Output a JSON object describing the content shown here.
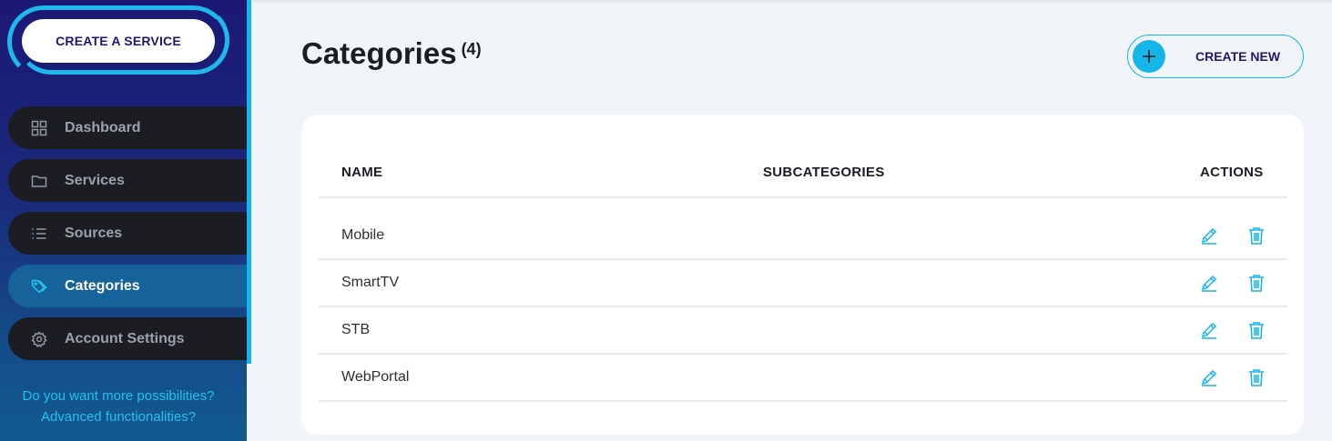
{
  "sidebar": {
    "create_service_label": "CREATE A SERVICE",
    "items": [
      {
        "label": "Dashboard",
        "icon": "grid-icon",
        "active": false
      },
      {
        "label": "Services",
        "icon": "folder-icon",
        "active": false
      },
      {
        "label": "Sources",
        "icon": "list-icon",
        "active": false
      },
      {
        "label": "Categories",
        "icon": "tag-icon",
        "active": true
      },
      {
        "label": "Account Settings",
        "icon": "gear-icon",
        "active": false
      }
    ],
    "promo_line1": "Do you want more possibilities?",
    "promo_line2": "Advanced functionalities?"
  },
  "page": {
    "title": "Categories",
    "count": "(4)",
    "create_new_label": "CREATE NEW"
  },
  "table": {
    "headers": {
      "name": "NAME",
      "subcategories": "SUBCATEGORIES",
      "actions": "ACTIONS"
    },
    "rows": [
      {
        "name": "Mobile",
        "subcategories": ""
      },
      {
        "name": "SmartTV",
        "subcategories": ""
      },
      {
        "name": "STB",
        "subcategories": ""
      },
      {
        "name": "WebPortal",
        "subcategories": ""
      }
    ],
    "action_icons": [
      "pencil-icon",
      "trash-icon"
    ]
  },
  "colors": {
    "accent": "#14b5e8",
    "sidebar_dark": "#1b1873",
    "nav_item_bg": "#1b1d22",
    "nav_active_bg": "#16629a",
    "brand_text": "#1d1a6b"
  }
}
